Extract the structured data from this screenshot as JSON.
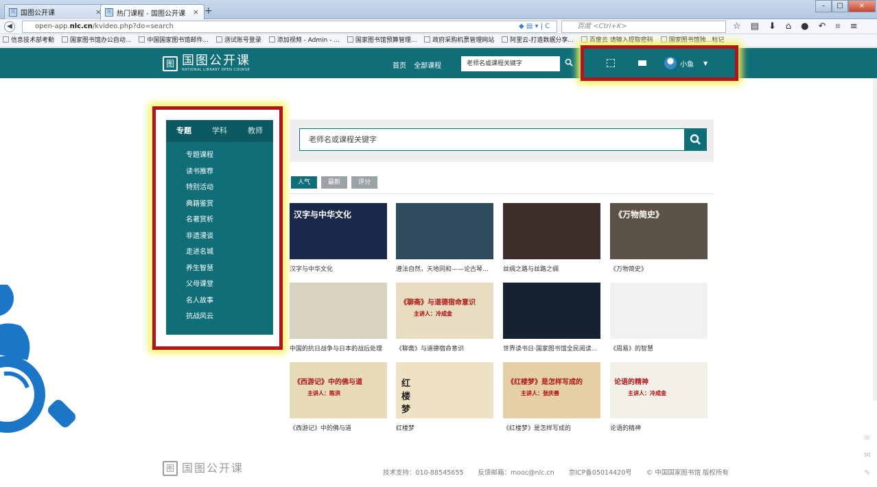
{
  "browser": {
    "tabs": [
      {
        "label": "国图公开课"
      },
      {
        "label": "热门课程 - 国图公开课"
      }
    ],
    "url_prefix": "open-app.",
    "url_domain": "nlc.cn",
    "url_path": "/kvideo.php?do=search",
    "search_placeholder": "百度 <Ctrl+K>",
    "bookmarks": [
      "信息技术部考勤",
      "国家图书馆办公自动...",
      "中国国家图书馆邮件...",
      "测试账号登录",
      "添加视频 - Admin - ...",
      "国家图书馆预算管理...",
      "政府采购机票管理网站",
      "阿里云-打造数据分享...",
      "百度云 请输入提取密码",
      "国家图书馆独...标记"
    ]
  },
  "header": {
    "logo_text": "国图公开课",
    "logo_sub": "NATIONAL LIBRARY OPEN COURSE",
    "nav": [
      "首页",
      "全部课程"
    ],
    "search_placeholder": "老师名或课程关键字",
    "user_name": "小鱼"
  },
  "left_panel": {
    "tabs": [
      "专题",
      "学科",
      "教师"
    ],
    "items": [
      "专题课程",
      "读书推荐",
      "特别活动",
      "典籍鉴赏",
      "名著赏析",
      "非遗漫谈",
      "走进名城",
      "养生智慧",
      "父母课堂",
      "名人故事",
      "抗战风云"
    ]
  },
  "main": {
    "search_placeholder": "老师名或课程关键字",
    "sort": [
      "人气",
      "最新",
      "评分"
    ],
    "courses": [
      {
        "title": "汉字与中华文化",
        "thumb_text": "汉字与中华文化",
        "thumb_sub": "",
        "color": "#1b2a4a"
      },
      {
        "title": "遵法自然，天地同和——论古琴...",
        "thumb_text": "",
        "thumb_sub": "",
        "color": "#2f4a5c"
      },
      {
        "title": "丝绸之路与丝路之绸",
        "thumb_text": "",
        "thumb_sub": "",
        "color": "#3b2e2a"
      },
      {
        "title": "《万物简史》",
        "thumb_text": "《万物简史》",
        "thumb_sub": "",
        "color": "#5c5246"
      },
      {
        "title": "中国的抗日战争与日本的战后处理",
        "thumb_text": "",
        "thumb_sub": "",
        "color": "#d8d2c3"
      },
      {
        "title": "《聊斋》与道德宿命意识",
        "thumb_text": "《聊斋》与道德宿命意识",
        "thumb_sub": "主讲人：冷成金",
        "color": "#e7dcc0"
      },
      {
        "title": "世界读书日·国家图书馆全民阅读...",
        "thumb_text": "",
        "thumb_sub": "",
        "color": "#152230"
      },
      {
        "title": "《周易》的智慧",
        "thumb_text": "",
        "thumb_sub": "",
        "color": "#f1f1f1"
      },
      {
        "title": "《西游记》中的佛与道",
        "thumb_text": "《西游记》中的佛与道",
        "thumb_sub": "主讲人：陈洪",
        "color": "#e6dab9"
      },
      {
        "title": "红楼梦",
        "thumb_text": "红楼梦",
        "thumb_sub": "",
        "color": "#efe2c4"
      },
      {
        "title": "《红楼梦》是怎样写成的",
        "thumb_text": "《红楼梦》是怎样写成的",
        "thumb_sub": "主讲人：张庆善",
        "color": "#e4cfa6"
      },
      {
        "title": "论语的精神",
        "thumb_text": "论语的精神",
        "thumb_sub": "主讲人：冷成金",
        "color": "#f3f0ea"
      }
    ]
  },
  "footer": {
    "logo_text": "国图公开课",
    "tech": "技术支持：010-88545655",
    "feedback": "反馈邮箱：mooc@nlc.cn",
    "icp": "京ICP备05014420号",
    "copyright": "© 中国国家图书馆 版权所有"
  },
  "colors": {
    "brand": "#0f6e78",
    "highlight_border": "#b3131b",
    "highlight_glow": "#f7f35c"
  }
}
